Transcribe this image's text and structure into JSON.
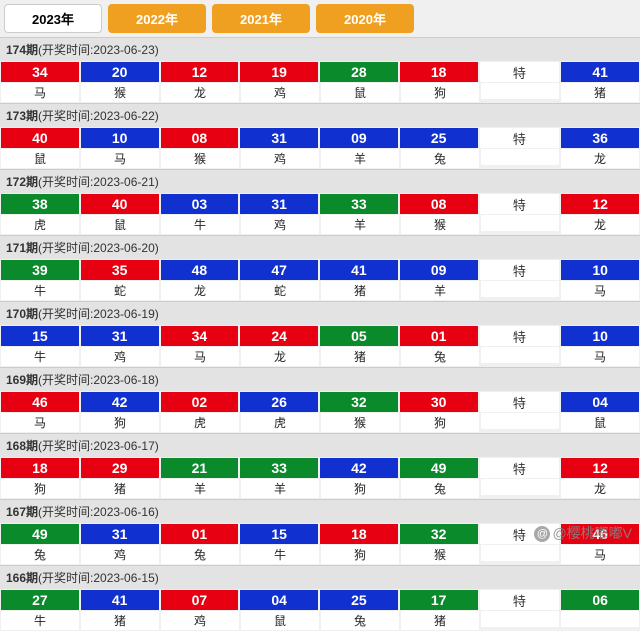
{
  "tabs": [
    "2023年",
    "2022年",
    "2021年",
    "2020年"
  ],
  "active_tab": 0,
  "special_label": "特",
  "watermark": "@樱桃嘟嘟V",
  "draws": [
    {
      "period": "174期",
      "time": "2023-06-23",
      "balls": [
        {
          "n": "34",
          "c": "red",
          "z": "马"
        },
        {
          "n": "20",
          "c": "blue",
          "z": "猴"
        },
        {
          "n": "12",
          "c": "red",
          "z": "龙"
        },
        {
          "n": "19",
          "c": "red",
          "z": "鸡"
        },
        {
          "n": "28",
          "c": "green",
          "z": "鼠"
        },
        {
          "n": "18",
          "c": "red",
          "z": "狗"
        }
      ],
      "special": {
        "n": "41",
        "c": "blue",
        "z": "猪"
      }
    },
    {
      "period": "173期",
      "time": "2023-06-22",
      "balls": [
        {
          "n": "40",
          "c": "red",
          "z": "鼠"
        },
        {
          "n": "10",
          "c": "blue",
          "z": "马"
        },
        {
          "n": "08",
          "c": "red",
          "z": "猴"
        },
        {
          "n": "31",
          "c": "blue",
          "z": "鸡"
        },
        {
          "n": "09",
          "c": "blue",
          "z": "羊"
        },
        {
          "n": "25",
          "c": "blue",
          "z": "兔"
        }
      ],
      "special": {
        "n": "36",
        "c": "blue",
        "z": "龙"
      }
    },
    {
      "period": "172期",
      "time": "2023-06-21",
      "balls": [
        {
          "n": "38",
          "c": "green",
          "z": "虎"
        },
        {
          "n": "40",
          "c": "red",
          "z": "鼠"
        },
        {
          "n": "03",
          "c": "blue",
          "z": "牛"
        },
        {
          "n": "31",
          "c": "blue",
          "z": "鸡"
        },
        {
          "n": "33",
          "c": "green",
          "z": "羊"
        },
        {
          "n": "08",
          "c": "red",
          "z": "猴"
        }
      ],
      "special": {
        "n": "12",
        "c": "red",
        "z": "龙"
      }
    },
    {
      "period": "171期",
      "time": "2023-06-20",
      "balls": [
        {
          "n": "39",
          "c": "green",
          "z": "牛"
        },
        {
          "n": "35",
          "c": "red",
          "z": "蛇"
        },
        {
          "n": "48",
          "c": "blue",
          "z": "龙"
        },
        {
          "n": "47",
          "c": "blue",
          "z": "蛇"
        },
        {
          "n": "41",
          "c": "blue",
          "z": "猪"
        },
        {
          "n": "09",
          "c": "blue",
          "z": "羊"
        }
      ],
      "special": {
        "n": "10",
        "c": "blue",
        "z": "马"
      }
    },
    {
      "period": "170期",
      "time": "2023-06-19",
      "balls": [
        {
          "n": "15",
          "c": "blue",
          "z": "牛"
        },
        {
          "n": "31",
          "c": "blue",
          "z": "鸡"
        },
        {
          "n": "34",
          "c": "red",
          "z": "马"
        },
        {
          "n": "24",
          "c": "red",
          "z": "龙"
        },
        {
          "n": "05",
          "c": "green",
          "z": "猪"
        },
        {
          "n": "01",
          "c": "red",
          "z": "兔"
        }
      ],
      "special": {
        "n": "10",
        "c": "blue",
        "z": "马"
      }
    },
    {
      "period": "169期",
      "time": "2023-06-18",
      "balls": [
        {
          "n": "46",
          "c": "red",
          "z": "马"
        },
        {
          "n": "42",
          "c": "blue",
          "z": "狗"
        },
        {
          "n": "02",
          "c": "red",
          "z": "虎"
        },
        {
          "n": "26",
          "c": "blue",
          "z": "虎"
        },
        {
          "n": "32",
          "c": "green",
          "z": "猴"
        },
        {
          "n": "30",
          "c": "red",
          "z": "狗"
        }
      ],
      "special": {
        "n": "04",
        "c": "blue",
        "z": "鼠"
      }
    },
    {
      "period": "168期",
      "time": "2023-06-17",
      "balls": [
        {
          "n": "18",
          "c": "red",
          "z": "狗"
        },
        {
          "n": "29",
          "c": "red",
          "z": "猪"
        },
        {
          "n": "21",
          "c": "green",
          "z": "羊"
        },
        {
          "n": "33",
          "c": "green",
          "z": "羊"
        },
        {
          "n": "42",
          "c": "blue",
          "z": "狗"
        },
        {
          "n": "49",
          "c": "green",
          "z": "兔"
        }
      ],
      "special": {
        "n": "12",
        "c": "red",
        "z": "龙"
      }
    },
    {
      "period": "167期",
      "time": "2023-06-16",
      "balls": [
        {
          "n": "49",
          "c": "green",
          "z": "兔"
        },
        {
          "n": "31",
          "c": "blue",
          "z": "鸡"
        },
        {
          "n": "01",
          "c": "red",
          "z": "兔"
        },
        {
          "n": "15",
          "c": "blue",
          "z": "牛"
        },
        {
          "n": "18",
          "c": "red",
          "z": "狗"
        },
        {
          "n": "32",
          "c": "green",
          "z": "猴"
        }
      ],
      "special": {
        "n": "46",
        "c": "red",
        "z": "马"
      }
    },
    {
      "period": "166期",
      "time": "2023-06-15",
      "balls": [
        {
          "n": "27",
          "c": "green",
          "z": "牛"
        },
        {
          "n": "41",
          "c": "blue",
          "z": "猪"
        },
        {
          "n": "07",
          "c": "red",
          "z": "鸡"
        },
        {
          "n": "04",
          "c": "blue",
          "z": "鼠"
        },
        {
          "n": "25",
          "c": "blue",
          "z": "兔"
        },
        {
          "n": "17",
          "c": "green",
          "z": "猪"
        }
      ],
      "special": {
        "n": "06",
        "c": "green",
        "z": ""
      }
    }
  ]
}
